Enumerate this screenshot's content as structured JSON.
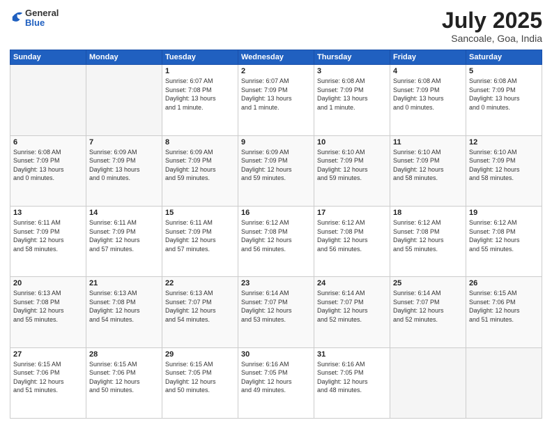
{
  "header": {
    "logo_general": "General",
    "logo_blue": "Blue",
    "title": "July 2025",
    "subtitle": "Sancoale, Goa, India"
  },
  "columns": [
    "Sunday",
    "Monday",
    "Tuesday",
    "Wednesday",
    "Thursday",
    "Friday",
    "Saturday"
  ],
  "weeks": [
    {
      "days": [
        {
          "num": "",
          "info": ""
        },
        {
          "num": "",
          "info": ""
        },
        {
          "num": "1",
          "info": "Sunrise: 6:07 AM\nSunset: 7:08 PM\nDaylight: 13 hours\nand 1 minute."
        },
        {
          "num": "2",
          "info": "Sunrise: 6:07 AM\nSunset: 7:09 PM\nDaylight: 13 hours\nand 1 minute."
        },
        {
          "num": "3",
          "info": "Sunrise: 6:08 AM\nSunset: 7:09 PM\nDaylight: 13 hours\nand 1 minute."
        },
        {
          "num": "4",
          "info": "Sunrise: 6:08 AM\nSunset: 7:09 PM\nDaylight: 13 hours\nand 0 minutes."
        },
        {
          "num": "5",
          "info": "Sunrise: 6:08 AM\nSunset: 7:09 PM\nDaylight: 13 hours\nand 0 minutes."
        }
      ]
    },
    {
      "days": [
        {
          "num": "6",
          "info": "Sunrise: 6:08 AM\nSunset: 7:09 PM\nDaylight: 13 hours\nand 0 minutes."
        },
        {
          "num": "7",
          "info": "Sunrise: 6:09 AM\nSunset: 7:09 PM\nDaylight: 13 hours\nand 0 minutes."
        },
        {
          "num": "8",
          "info": "Sunrise: 6:09 AM\nSunset: 7:09 PM\nDaylight: 12 hours\nand 59 minutes."
        },
        {
          "num": "9",
          "info": "Sunrise: 6:09 AM\nSunset: 7:09 PM\nDaylight: 12 hours\nand 59 minutes."
        },
        {
          "num": "10",
          "info": "Sunrise: 6:10 AM\nSunset: 7:09 PM\nDaylight: 12 hours\nand 59 minutes."
        },
        {
          "num": "11",
          "info": "Sunrise: 6:10 AM\nSunset: 7:09 PM\nDaylight: 12 hours\nand 58 minutes."
        },
        {
          "num": "12",
          "info": "Sunrise: 6:10 AM\nSunset: 7:09 PM\nDaylight: 12 hours\nand 58 minutes."
        }
      ]
    },
    {
      "days": [
        {
          "num": "13",
          "info": "Sunrise: 6:11 AM\nSunset: 7:09 PM\nDaylight: 12 hours\nand 58 minutes."
        },
        {
          "num": "14",
          "info": "Sunrise: 6:11 AM\nSunset: 7:09 PM\nDaylight: 12 hours\nand 57 minutes."
        },
        {
          "num": "15",
          "info": "Sunrise: 6:11 AM\nSunset: 7:09 PM\nDaylight: 12 hours\nand 57 minutes."
        },
        {
          "num": "16",
          "info": "Sunrise: 6:12 AM\nSunset: 7:08 PM\nDaylight: 12 hours\nand 56 minutes."
        },
        {
          "num": "17",
          "info": "Sunrise: 6:12 AM\nSunset: 7:08 PM\nDaylight: 12 hours\nand 56 minutes."
        },
        {
          "num": "18",
          "info": "Sunrise: 6:12 AM\nSunset: 7:08 PM\nDaylight: 12 hours\nand 55 minutes."
        },
        {
          "num": "19",
          "info": "Sunrise: 6:12 AM\nSunset: 7:08 PM\nDaylight: 12 hours\nand 55 minutes."
        }
      ]
    },
    {
      "days": [
        {
          "num": "20",
          "info": "Sunrise: 6:13 AM\nSunset: 7:08 PM\nDaylight: 12 hours\nand 55 minutes."
        },
        {
          "num": "21",
          "info": "Sunrise: 6:13 AM\nSunset: 7:08 PM\nDaylight: 12 hours\nand 54 minutes."
        },
        {
          "num": "22",
          "info": "Sunrise: 6:13 AM\nSunset: 7:07 PM\nDaylight: 12 hours\nand 54 minutes."
        },
        {
          "num": "23",
          "info": "Sunrise: 6:14 AM\nSunset: 7:07 PM\nDaylight: 12 hours\nand 53 minutes."
        },
        {
          "num": "24",
          "info": "Sunrise: 6:14 AM\nSunset: 7:07 PM\nDaylight: 12 hours\nand 52 minutes."
        },
        {
          "num": "25",
          "info": "Sunrise: 6:14 AM\nSunset: 7:07 PM\nDaylight: 12 hours\nand 52 minutes."
        },
        {
          "num": "26",
          "info": "Sunrise: 6:15 AM\nSunset: 7:06 PM\nDaylight: 12 hours\nand 51 minutes."
        }
      ]
    },
    {
      "days": [
        {
          "num": "27",
          "info": "Sunrise: 6:15 AM\nSunset: 7:06 PM\nDaylight: 12 hours\nand 51 minutes."
        },
        {
          "num": "28",
          "info": "Sunrise: 6:15 AM\nSunset: 7:06 PM\nDaylight: 12 hours\nand 50 minutes."
        },
        {
          "num": "29",
          "info": "Sunrise: 6:15 AM\nSunset: 7:05 PM\nDaylight: 12 hours\nand 50 minutes."
        },
        {
          "num": "30",
          "info": "Sunrise: 6:16 AM\nSunset: 7:05 PM\nDaylight: 12 hours\nand 49 minutes."
        },
        {
          "num": "31",
          "info": "Sunrise: 6:16 AM\nSunset: 7:05 PM\nDaylight: 12 hours\nand 48 minutes."
        },
        {
          "num": "",
          "info": ""
        },
        {
          "num": "",
          "info": ""
        }
      ]
    }
  ]
}
